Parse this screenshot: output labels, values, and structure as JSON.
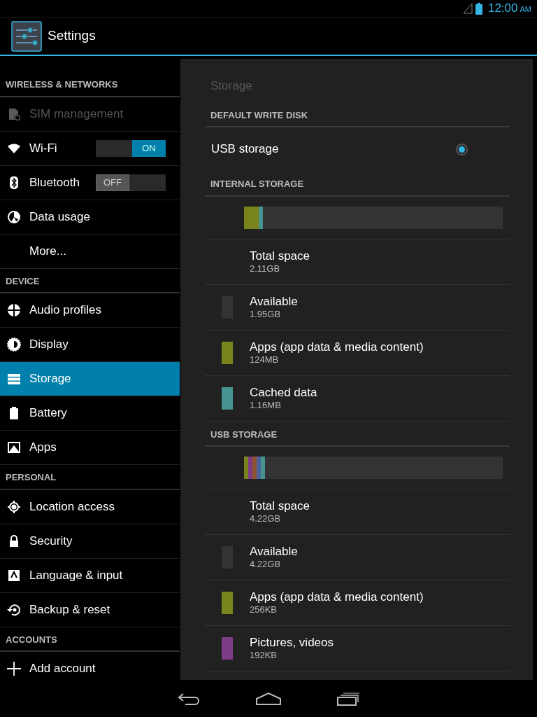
{
  "status_bar": {
    "time": "12:00",
    "meridiem": "AM"
  },
  "action_bar": {
    "title": "Settings"
  },
  "sidebar": {
    "sections": [
      {
        "header": "WIRELESS & NETWORKS",
        "items": [
          {
            "label": "SIM management",
            "selected": false,
            "disabled": true
          },
          {
            "label": "Wi-Fi",
            "selected": false,
            "disabled": false,
            "toggle": {
              "label": "ON",
              "on": true
            }
          },
          {
            "label": "Bluetooth",
            "selected": false,
            "disabled": false,
            "toggle": {
              "label": "OFF",
              "on": false
            }
          },
          {
            "label": "Data usage",
            "selected": false,
            "disabled": false
          },
          {
            "label": "More...",
            "selected": false,
            "disabled": false
          }
        ]
      },
      {
        "header": "DEVICE",
        "items": [
          {
            "label": "Audio profiles",
            "selected": false,
            "disabled": false
          },
          {
            "label": "Display",
            "selected": false,
            "disabled": false
          },
          {
            "label": "Storage",
            "selected": true,
            "disabled": false
          },
          {
            "label": "Battery",
            "selected": false,
            "disabled": false
          },
          {
            "label": "Apps",
            "selected": false,
            "disabled": false
          }
        ]
      },
      {
        "header": "PERSONAL",
        "items": [
          {
            "label": "Location access",
            "selected": false,
            "disabled": false
          },
          {
            "label": "Security",
            "selected": false,
            "disabled": false
          },
          {
            "label": "Language & input",
            "selected": false,
            "disabled": false
          },
          {
            "label": "Backup & reset",
            "selected": false,
            "disabled": false
          }
        ]
      },
      {
        "header": "ACCOUNTS",
        "items": [
          {
            "label": "Add account",
            "selected": false,
            "disabled": false
          }
        ]
      }
    ]
  },
  "panel": {
    "title": "Storage",
    "sections": [
      {
        "header": "DEFAULT WRITE DISK",
        "kind": "choice",
        "options": [
          {
            "label": "USB storage",
            "selected": true
          }
        ]
      },
      {
        "header": "INTERNAL STORAGE",
        "kind": "usage",
        "bar": [
          {
            "color": "#7a841c",
            "level": 0.057
          },
          {
            "color": "#45948f",
            "level": 0.016
          }
        ],
        "rows": [
          {
            "title": "Total space",
            "value": "2.11GB"
          },
          {
            "title": "Available",
            "value": "1.95GB",
            "color": "#333333"
          },
          {
            "title": "Apps (app data & media content)",
            "value": "124MB",
            "color": "#7a841c"
          },
          {
            "title": "Cached data",
            "value": "1.16MB",
            "color": "#45948f"
          }
        ]
      },
      {
        "header": "USB STORAGE",
        "kind": "usage",
        "bar": [
          {
            "color": "#7a841c",
            "level": 0.016
          },
          {
            "color": "#7f3c86",
            "level": 0.016
          },
          {
            "color": "#8f5230",
            "level": 0.016
          },
          {
            "color": "#4a6499",
            "level": 0.016
          },
          {
            "color": "#45948f",
            "level": 0.016
          }
        ],
        "rows": [
          {
            "title": "Total space",
            "value": "4.22GB"
          },
          {
            "title": "Available",
            "value": "4.22GB",
            "color": "#333333"
          },
          {
            "title": "Apps (app data & media content)",
            "value": "256KB",
            "color": "#7a841c"
          },
          {
            "title": "Pictures, videos",
            "value": "192KB",
            "color": "#7f3c86"
          }
        ]
      }
    ]
  }
}
